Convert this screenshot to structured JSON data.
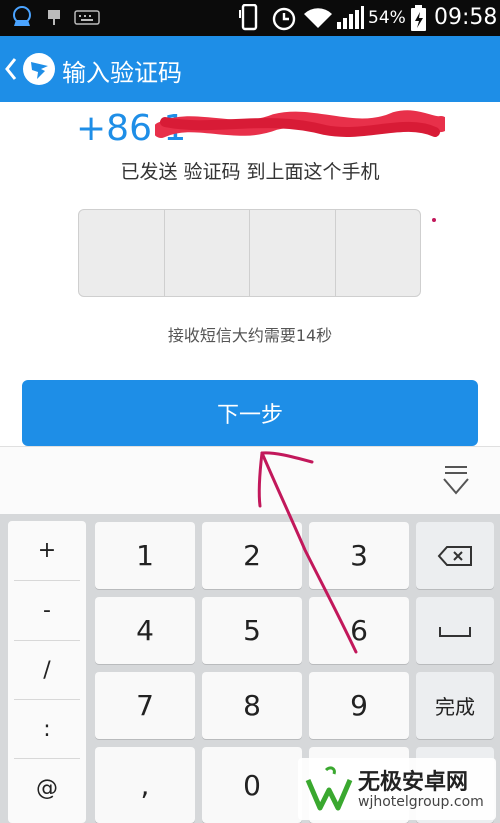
{
  "status_bar": {
    "battery": "54%",
    "time": "09:58",
    "icons": [
      "notification-app-icon",
      "usb-icon",
      "keyboard-icon",
      "phone-outline-icon",
      "alarm-icon",
      "wifi-icon",
      "signal-icon",
      "battery-charging-icon"
    ]
  },
  "app_bar": {
    "back_icon": "chevron-left-icon",
    "logo_icon": "dingtalk-logo-icon",
    "title": "输入验证码"
  },
  "content": {
    "phone_prefix": "+86 1",
    "sent_text": "已发送 验证码 到上面这个手机",
    "code_cells": [
      "",
      "",
      "",
      ""
    ],
    "countdown_hint": "接收短信大约需要14秒",
    "next_button": "下一步"
  },
  "keyboard": {
    "collapse_icon": "keyboard-collapse-icon",
    "symbols": [
      "+",
      "-",
      "/",
      ":",
      "@"
    ],
    "digits": [
      "1",
      "2",
      "3",
      "4",
      "5",
      "6",
      "7",
      "8",
      "9",
      ",",
      "0"
    ],
    "backspace_icon": "backspace-icon",
    "space_icon": "space-icon",
    "done_label": "完成"
  },
  "watermark": {
    "title": "无极安卓网",
    "url": "wjhotelgroup.com"
  },
  "colors": {
    "accent": "#1e8ee7",
    "annotation": "#c2185b"
  }
}
